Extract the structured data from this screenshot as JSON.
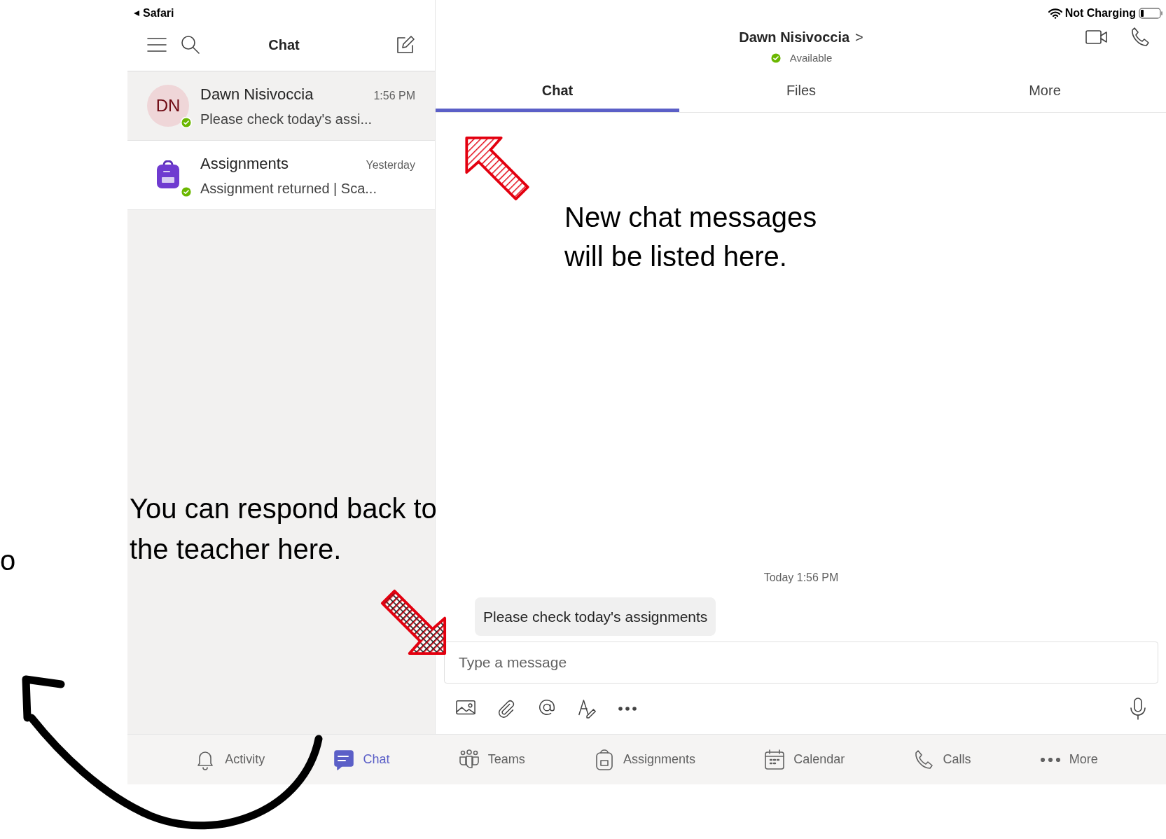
{
  "status_bar": {
    "back_label": "Safari",
    "battery_label": "Not Charging"
  },
  "chat_list": {
    "title": "Chat",
    "items": [
      {
        "name": "Dawn Nisivoccia",
        "initials": "DN",
        "kind": "person",
        "time": "1:56 PM",
        "preview": "Please check today's assi...",
        "selected": true,
        "online": true
      },
      {
        "name": "Assignments",
        "kind": "app",
        "time": "Yesterday",
        "preview": "Assignment returned | Sca...",
        "selected": false,
        "online": true
      }
    ]
  },
  "conversation": {
    "name": "Dawn Nisivoccia",
    "chevron": ">",
    "presence": "Available",
    "online": true,
    "tabs": [
      {
        "label": "Chat",
        "selected": true
      },
      {
        "label": "Files",
        "selected": false
      },
      {
        "label": "More",
        "selected": false
      }
    ],
    "timestamp": "Today 1:56 PM",
    "messages": [
      "Please check today's assignments"
    ],
    "composer": {
      "placeholder": "Type a message"
    }
  },
  "bottom_nav": [
    {
      "label": "Activity",
      "kind": "bell",
      "selected": false
    },
    {
      "label": "Chat",
      "kind": "chat",
      "selected": true
    },
    {
      "label": "Teams",
      "kind": "teams",
      "selected": false
    },
    {
      "label": "Assignments",
      "kind": "bag",
      "selected": false
    },
    {
      "label": "Calendar",
      "kind": "calendar",
      "selected": false
    },
    {
      "label": "Calls",
      "kind": "phone",
      "selected": false
    },
    {
      "label": "More",
      "kind": "dots",
      "selected": false
    }
  ],
  "annotations": [
    {
      "text": "New chat messages will be listed here."
    },
    {
      "text": "You can respond back to the teacher here."
    },
    {
      "text": "o"
    }
  ]
}
